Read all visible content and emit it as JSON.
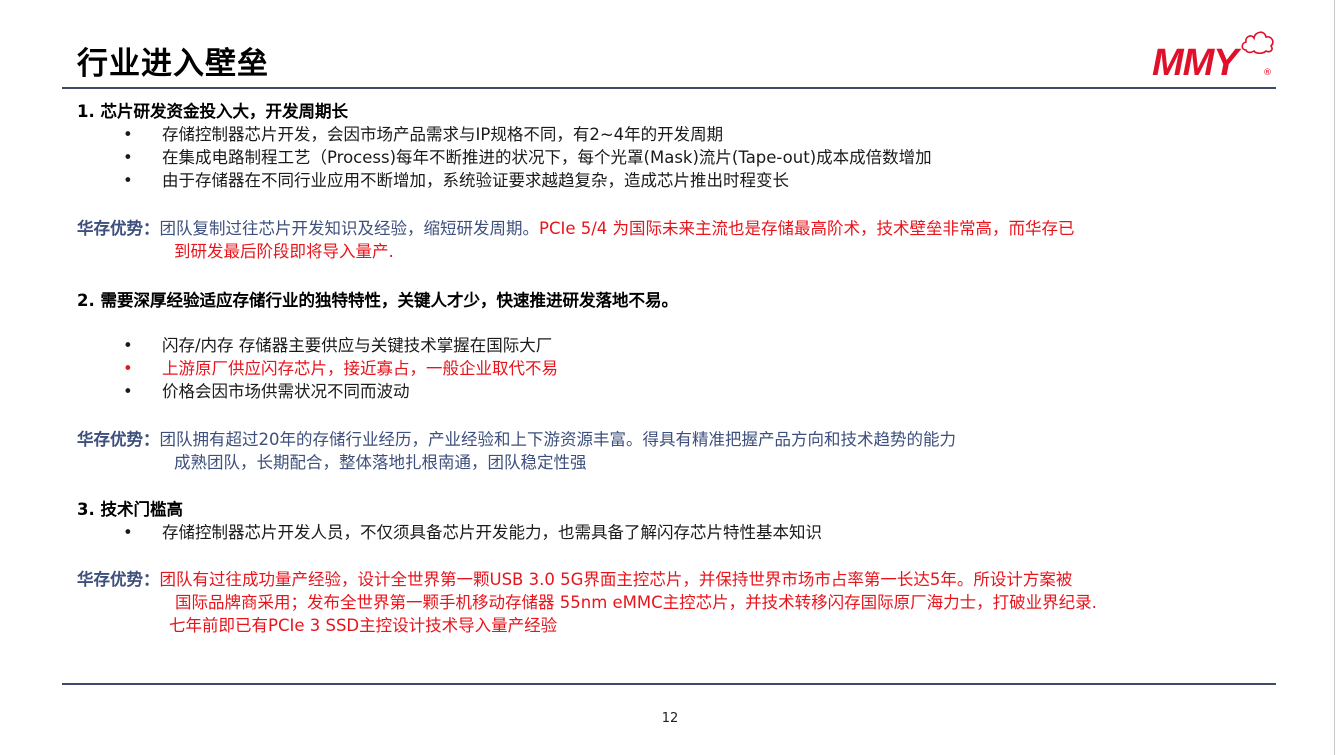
{
  "title": "行业进入壁垒",
  "logo": {
    "text": "MMY",
    "reg": "®"
  },
  "sections": [
    {
      "heading": "1. 芯片研发资金投入大，开发周期长",
      "bullets": [
        "存储控制器芯片开发，会因市场产品需求与IP规格不同，有2~4年的开发周期",
        "在集成电路制程工艺（Process)每年不断推进的状况下，每个光罩(Mask)流片(Tape-out)成本成倍数增加",
        "由于存储器在不同行业应用不断增加，系统验证要求越趋复杂，造成芯片推出时程变长"
      ],
      "advantage": {
        "label": "华存优势：",
        "line1_blue": "团队复制过往芯片开发知识及经验，缩短研发周期。",
        "line1_red": "PCIe 5/4 为国际未来主流也是存储最高阶术，技术壁垒非常高，而华存已",
        "line2_red": "到研发最后阶段即将导入量产."
      }
    },
    {
      "heading": "2. 需要深厚经验适应存储行业的独特特性，关键人才少，快速推进研发落地不易。",
      "bullets": [
        "闪存/内存 存储器主要供应与关键技术掌握在国际大厂",
        "上游原厂供应闪存芯片，接近寡占，一般企业取代不易",
        "价格会因市场供需状况不同而波动"
      ],
      "advantage": {
        "label": "华存优势：",
        "line1": "团队拥有超过20年的存储行业经历，产业经验和上下游资源丰富。得具有精准把握产品方向和技术趋势的能力",
        "line2": "成熟团队，长期配合，整体落地扎根南通，团队稳定性强"
      }
    },
    {
      "heading": "3. 技术门槛高",
      "bullets": [
        "存储控制器芯片开发人员，不仅须具备芯片开发能力，也需具备了解闪存芯片特性基本知识"
      ],
      "advantage": {
        "label": "华存优势：",
        "line1": "团队有过往成功量产经验，设计全世界第一颗USB 3.0 5G界面主控芯片，并保持世界市场市占率第一长达5年。所设计方案被",
        "line2": "国际品牌商采用；发布全世界第一颗手机移动存储器 55nm eMMC主控芯片，并技术转移闪存国际原厂海力士，打破业界纪录.",
        "line3": "七年前即已有PCIe 3 SSD主控设计技术导入量产经验"
      }
    }
  ],
  "bullet_symbol": "•",
  "page_number": "12"
}
